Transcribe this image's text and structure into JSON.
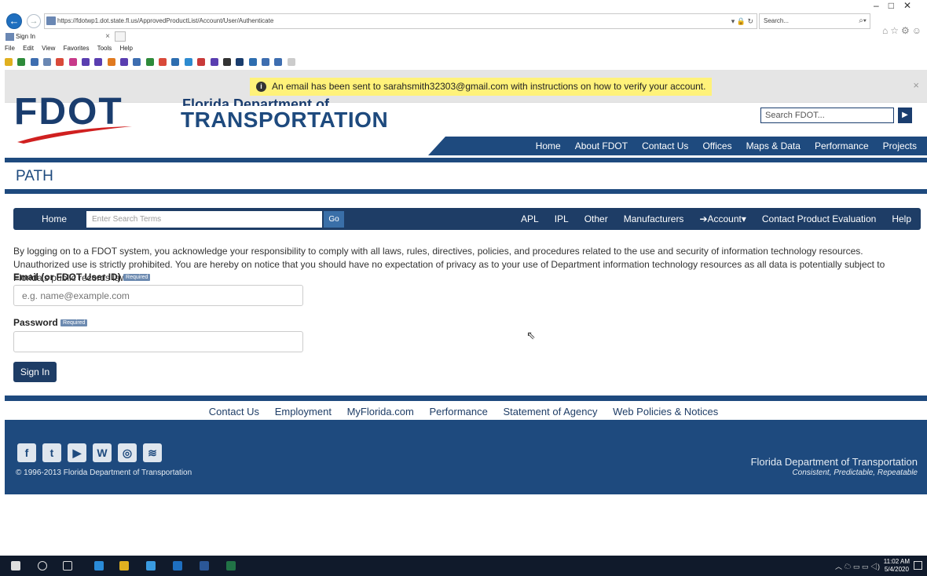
{
  "browser": {
    "url": "https://fdotwp1.dot.state.fl.us/ApprovedProductList/Account/User/Authenticate",
    "search_placeholder": "Search...",
    "tab_title": "Sign In",
    "menu": [
      "File",
      "Edit",
      "View",
      "Favorites",
      "Tools",
      "Help"
    ]
  },
  "notification": {
    "message": "An email has been sent to sarahsmith32303@gmail.com with instructions on how to verify your account.",
    "close": "×"
  },
  "header": {
    "logo_text": "FDOT",
    "org_small": "Florida Department of",
    "org_big": "TRANSPORTATION",
    "search_placeholder": "Search FDOT...",
    "search_go": "▶"
  },
  "topnav": [
    "Home",
    "About FDOT",
    "Contact Us",
    "Offices",
    "Maps & Data",
    "Performance",
    "Projects"
  ],
  "page_title": "PATH",
  "appnav": {
    "home": "Home",
    "search_placeholder": "Enter Search Terms",
    "go": "Go",
    "items": [
      "APL",
      "IPL",
      "Other",
      "Manufacturers",
      "Account",
      "Contact Product Evaluation",
      "Help"
    ]
  },
  "legal": "By logging on to a FDOT system, you acknowledge your responsibility to comply with all laws, rules, directives, policies, and procedures related to the use and security of information technology resources. Unauthorized use is strictly prohibited. You are hereby on notice that you should have no expectation of privacy as to your use of Department information technology resources as all data is potentially subject to Florida's public records law.",
  "form": {
    "email_label": "Email (or FDOT User ID)",
    "email_placeholder": "e.g. name@example.com",
    "password_label": "Password",
    "required": "Required",
    "submit": "Sign In"
  },
  "footer": {
    "links": [
      "Contact Us",
      "Employment",
      "MyFlorida.com",
      "Performance",
      "Statement of Agency",
      "Web Policies & Notices"
    ],
    "copyright": "© 1996-2013 Florida Department of Transportation",
    "org": "Florida Department of Transportation",
    "tagline": "Consistent, Predictable, Repeatable"
  },
  "taskbar": {
    "time": "11:02 AM",
    "date": "5/4/2020"
  },
  "colors": {
    "brand": "#1e4a7e",
    "notif": "#fff27a"
  }
}
